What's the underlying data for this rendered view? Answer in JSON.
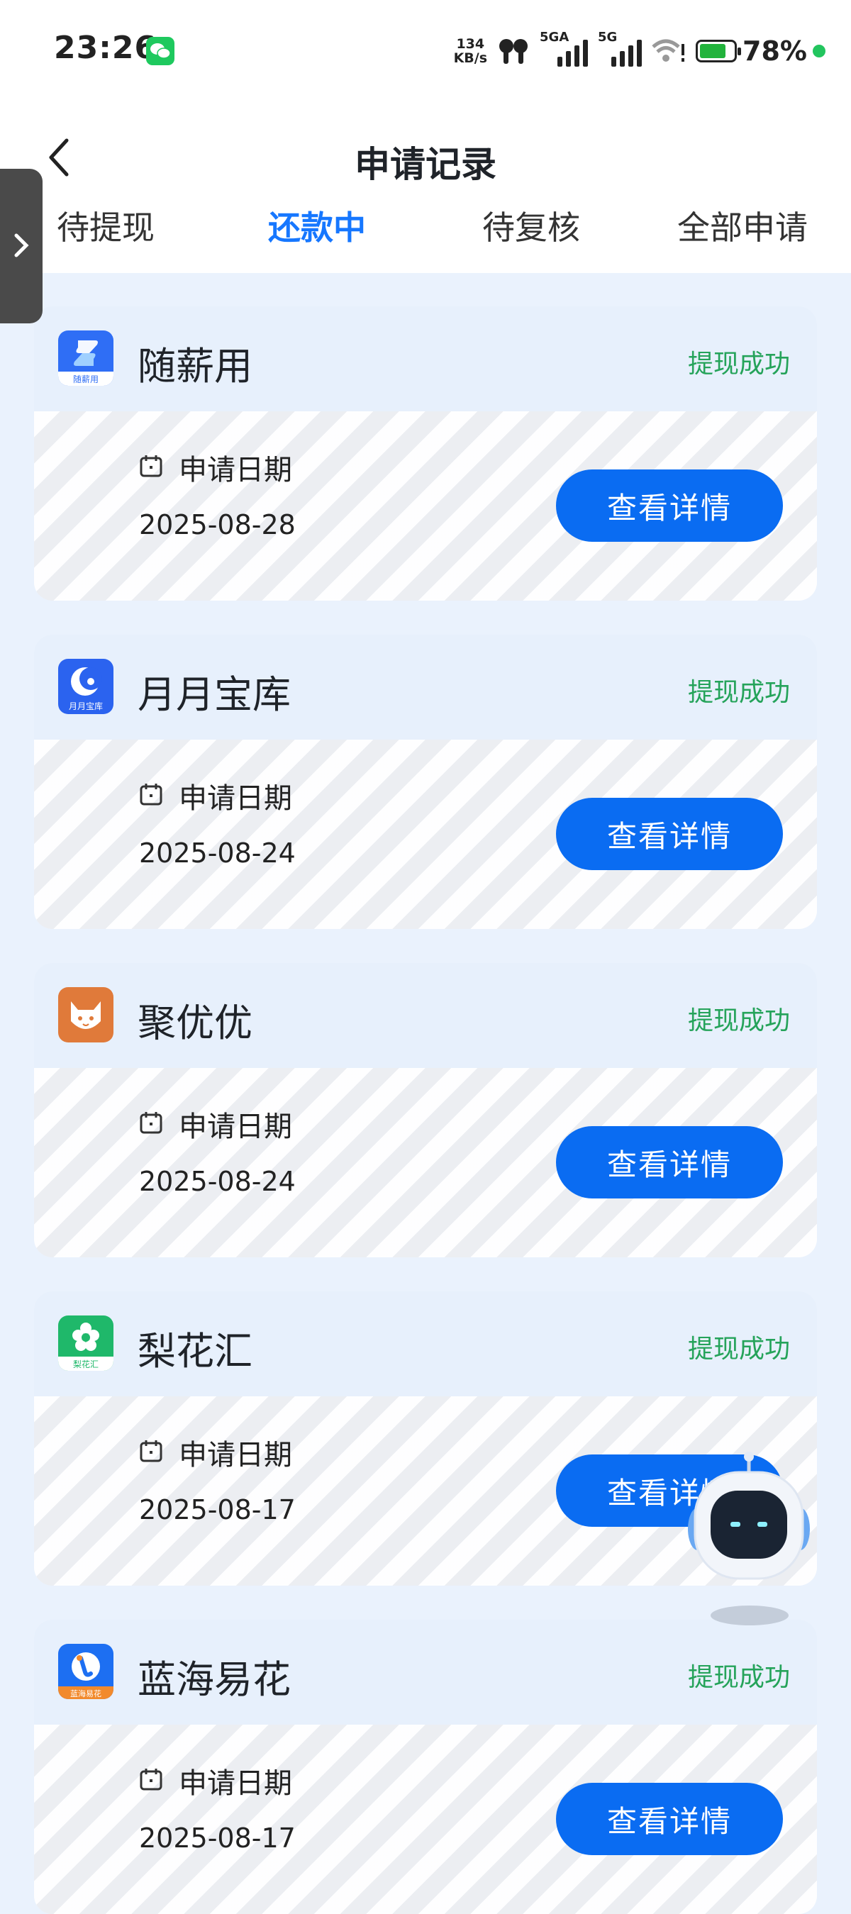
{
  "status_bar": {
    "time": "23:26",
    "net_speed_value": "134",
    "net_speed_unit": "KB/s",
    "sim1_label": "5GA",
    "sim2_label": "5G",
    "battery_percent": "78%",
    "battery_level": 0.78
  },
  "header": {
    "title": "申请记录",
    "tabs": [
      {
        "label": "待提现",
        "active": false
      },
      {
        "label": "还款中",
        "active": true
      },
      {
        "label": "待复核",
        "active": false
      },
      {
        "label": "全部申请",
        "active": false
      }
    ]
  },
  "records": [
    {
      "app_name": "随薪用",
      "logo_text": "随薪用",
      "status": "提现成功",
      "date_label": "申请日期",
      "date": "2025-08-28",
      "button": "查看详情"
    },
    {
      "app_name": "月月宝库",
      "logo_text": "月月宝库",
      "status": "提现成功",
      "date_label": "申请日期",
      "date": "2025-08-24",
      "button": "查看详情"
    },
    {
      "app_name": "聚优优",
      "logo_text": "",
      "status": "提现成功",
      "date_label": "申请日期",
      "date": "2025-08-24",
      "button": "查看详情"
    },
    {
      "app_name": "梨花汇",
      "logo_text": "梨花汇",
      "status": "提现成功",
      "date_label": "申请日期",
      "date": "2025-08-17",
      "button": "查看详情"
    },
    {
      "app_name": "蓝海易花",
      "logo_text": "蓝海易花",
      "status": "提现成功",
      "date_label": "申请日期",
      "date": "2025-08-17",
      "button": "查看详情"
    }
  ],
  "colors": {
    "accent": "#1677ff",
    "button": "#0a6cf2",
    "status_success": "#25a35a",
    "page_bg": "#eaf2fd"
  },
  "icons": [
    "wechat-icon",
    "earbuds-icon",
    "wifi-icon",
    "battery-icon",
    "back-arrow-icon",
    "chevron-right-icon",
    "calendar-icon",
    "assistant-robot-icon"
  ]
}
